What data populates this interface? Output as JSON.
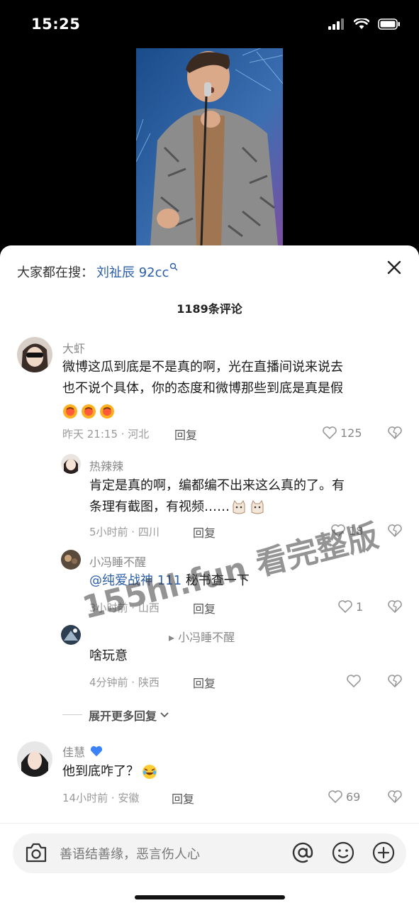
{
  "status": {
    "time": "15:25"
  },
  "header": {
    "search_prefix": "大家都在搜：",
    "search_term": "刘祉辰 92cc"
  },
  "comment_count": "1189条评论",
  "comments": [
    {
      "user": "大虾",
      "text_line1": "微博这瓜到底是不是真的啊，光在直播间说来说去",
      "text_line2": "也不说个具体，你的态度和微博那些到底是真是假",
      "meta": "昨天 21:15 · 河北",
      "reply": "回复",
      "likes": "125"
    },
    {
      "user": "热辣辣",
      "text_line1": "肯定是真的啊，编都编不出来这么真的了。有",
      "text_line2": "条理有截图，有视频……",
      "meta": "5小时前 · 四川",
      "reply": "回复",
      "likes": "18"
    },
    {
      "user": "小冯睡不醒",
      "mention": "@纯爱战神 111",
      "text": "秘书查一下",
      "meta": "3小时前 · 山西",
      "reply": "回复",
      "likes": "1"
    },
    {
      "user_to": "▸ 小冯睡不醒",
      "text": "啥玩意",
      "meta": "4分钟前 · 陕西",
      "reply": "回复"
    },
    {
      "user": "佳慧",
      "text": "他到底咋了？",
      "meta": "14小时前 · 安徽",
      "reply": "回复",
      "likes": "69"
    }
  ],
  "expand_replies": "展开更多回复",
  "watermark": "155hl.fun 看完整版",
  "input": {
    "placeholder": "善语结善缘，恶言伤人心"
  },
  "colors": {
    "mention": "#2b5ea8",
    "heart_blue": "#3b82f6"
  },
  "icons": [
    "search-icon",
    "close-icon",
    "heart-icon",
    "dislike-heart-icon",
    "camera-icon",
    "at-icon",
    "emoji-icon",
    "plus-icon"
  ]
}
